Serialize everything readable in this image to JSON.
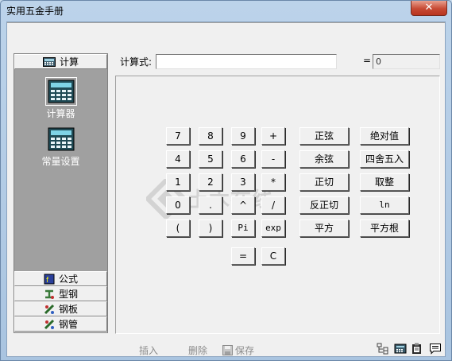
{
  "window": {
    "title": "实用五金手册",
    "close_glyph": "✕"
  },
  "nav": {
    "groups": [
      {
        "label": "计算",
        "icon": "calculator-icon"
      },
      {
        "label": "公式",
        "icon": "formula-book-icon"
      },
      {
        "label": "型钢",
        "icon": "steel-section-icon"
      },
      {
        "label": "钢板",
        "icon": "steel-plate-icon"
      },
      {
        "label": "钢管",
        "icon": "steel-pipe-icon"
      }
    ],
    "items": [
      {
        "label": "计算器",
        "icon": "calculator-icon",
        "active": true
      },
      {
        "label": "常量设置",
        "icon": "constants-calculator-icon",
        "active": false
      }
    ]
  },
  "formula": {
    "label": "计算式:",
    "value": "",
    "equals": "=",
    "result": "0"
  },
  "keypad": {
    "rows": [
      [
        "7",
        "8",
        "9",
        "+"
      ],
      [
        "4",
        "5",
        "6",
        "-"
      ],
      [
        "1",
        "2",
        "3",
        "*"
      ],
      [
        "0",
        ".",
        "^",
        "/"
      ],
      [
        "(",
        ")",
        "Pi",
        "exp"
      ]
    ],
    "functions": [
      [
        "正弦",
        "绝对值"
      ],
      [
        "余弦",
        "四舍五入"
      ],
      [
        "正切",
        "取整"
      ],
      [
        "反正切",
        "ln"
      ],
      [
        "平方",
        "平方根"
      ]
    ],
    "bottom": [
      "=",
      "C"
    ]
  },
  "watermark": {
    "text": "土木在线"
  },
  "toolbar": {
    "insert": "插入",
    "delete": "删除",
    "save": "保存"
  }
}
